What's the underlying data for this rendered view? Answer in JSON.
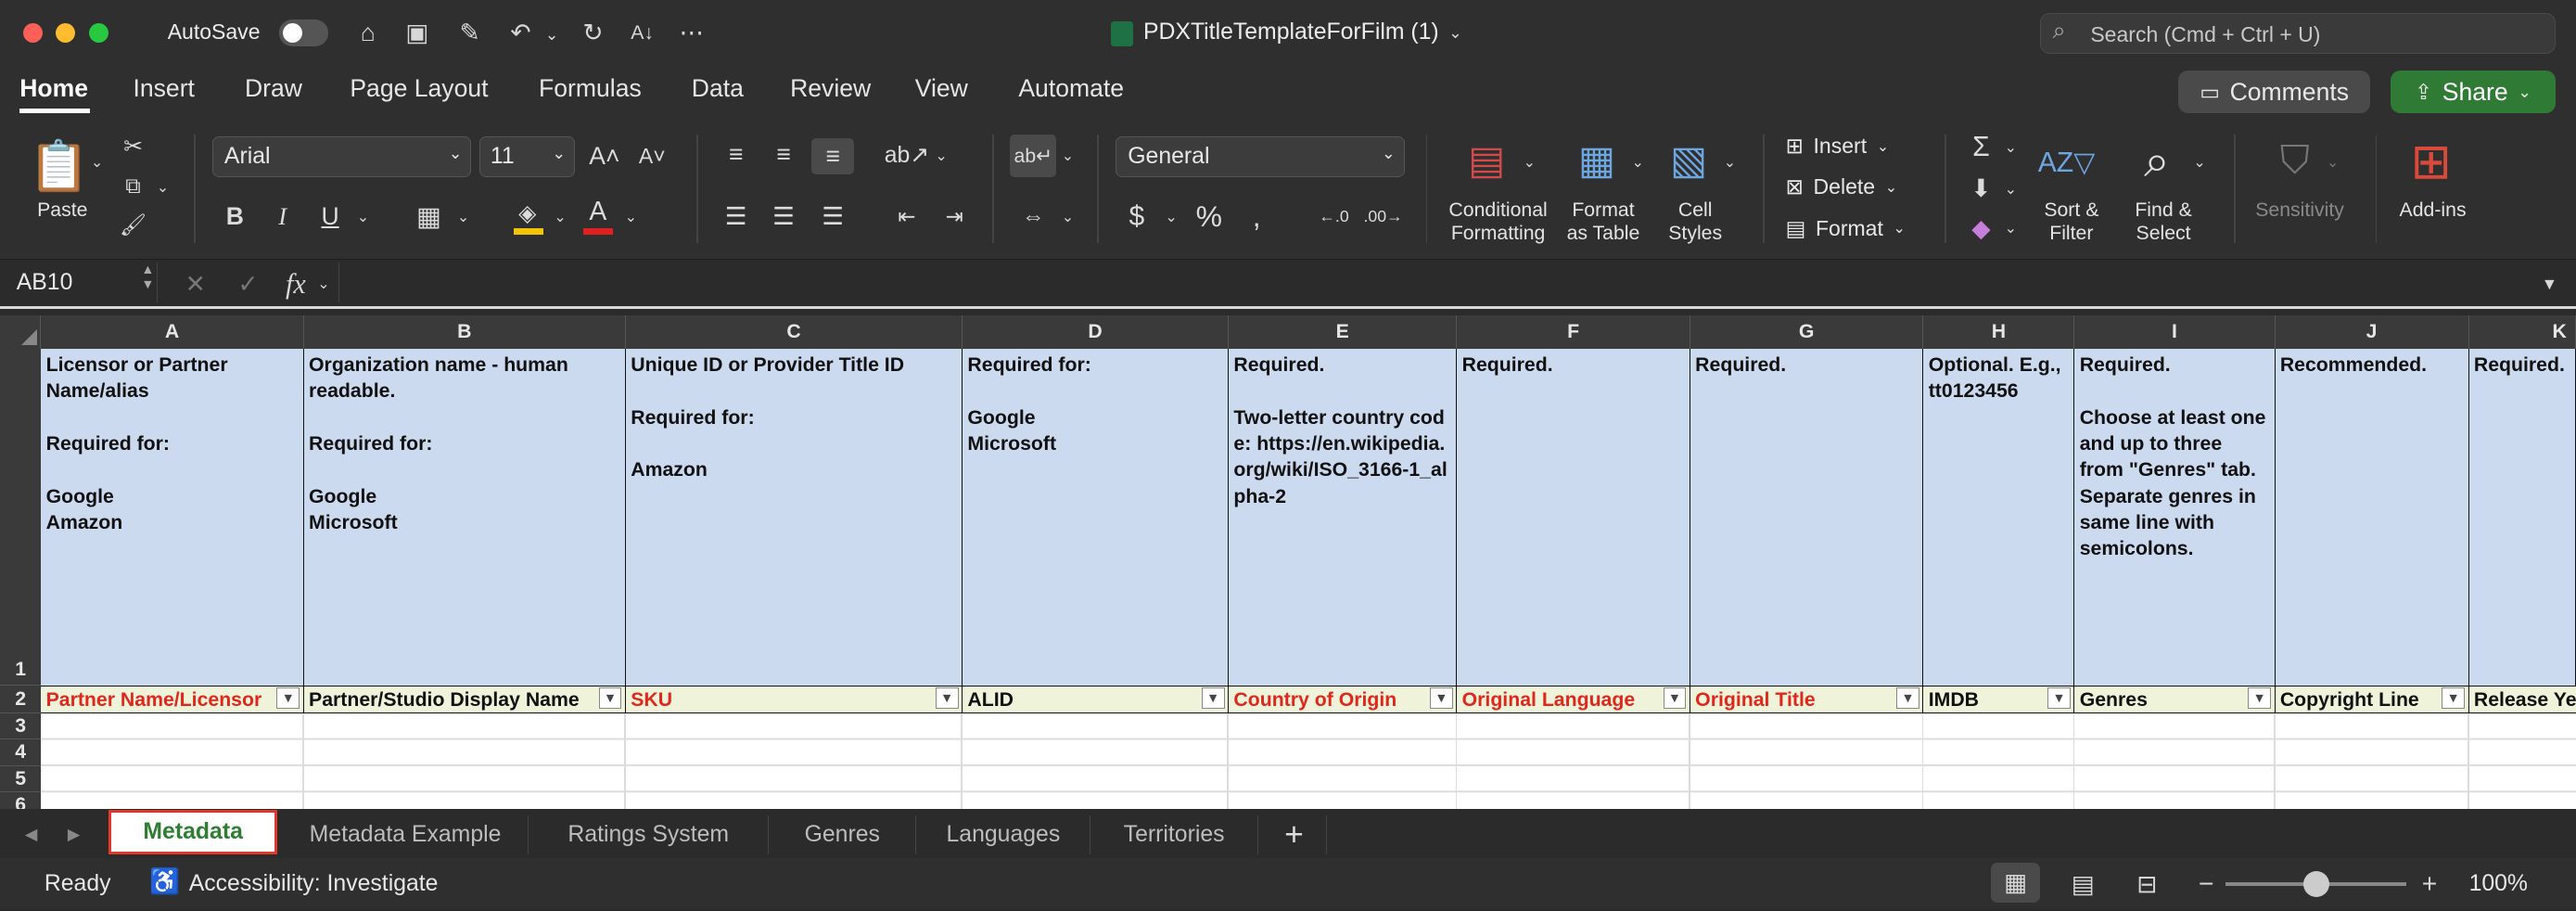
{
  "titlebar": {
    "autosave_label": "AutoSave",
    "doc_title": "PDXTitleTemplateForFilm (1)",
    "search_placeholder": "Search (Cmd + Ctrl + U)"
  },
  "menu_tabs": [
    "Home",
    "Insert",
    "Draw",
    "Page Layout",
    "Formulas",
    "Data",
    "Review",
    "View",
    "Automate"
  ],
  "actions": {
    "comments": "Comments",
    "share": "Share"
  },
  "ribbon": {
    "paste": "Paste",
    "font_name": "Arial",
    "font_size": "11",
    "number_format": "General",
    "conditional": [
      "Conditional",
      "Formatting"
    ],
    "format_table": [
      "Format",
      "as Table"
    ],
    "cell_styles": [
      "Cell",
      "Styles"
    ],
    "insert": "Insert",
    "delete": "Delete",
    "format": "Format",
    "sort_filter": [
      "Sort &",
      "Filter"
    ],
    "find_select": [
      "Find &",
      "Select"
    ],
    "sensitivity": "Sensitivity",
    "addins": "Add-ins"
  },
  "formula_bar": {
    "name_box": "AB10",
    "fx": "fx",
    "content": ""
  },
  "columns": [
    "A",
    "B",
    "C",
    "D",
    "E",
    "F",
    "G",
    "H",
    "I",
    "J",
    "K"
  ],
  "row_numbers": [
    "1",
    "2",
    "3",
    "4",
    "5",
    "6"
  ],
  "row1": [
    "Licensor or Partner Name/alias\n\nRequired for:\n\nGoogle\nAmazon",
    "Organization name - human readable.\n\nRequired for:\n\nGoogle\nMicrosoft",
    "Unique ID or Provider Title ID\n\nRequired for:\n\nAmazon",
    "Required for:\n\nGoogle\nMicrosoft",
    "Required.\n\nTwo-letter country code: https://en.wikipedia.org/wiki/ISO_3166-1_alpha-2",
    "Required.",
    "Required.",
    "Optional. E.g., tt0123456",
    "Required.\n\nChoose at least one and up to three from \"Genres\" tab. Separate genres in same line with semicolons.",
    "Recommended.",
    "Required."
  ],
  "row2": [
    {
      "text": "Partner Name/Licensor",
      "required": true
    },
    {
      "text": "Partner/Studio Display Name",
      "required": false
    },
    {
      "text": "SKU",
      "required": true
    },
    {
      "text": "ALID",
      "required": false
    },
    {
      "text": "Country of Origin",
      "required": true
    },
    {
      "text": "Original Language",
      "required": true
    },
    {
      "text": "Original Title",
      "required": true
    },
    {
      "text": "IMDB",
      "required": false
    },
    {
      "text": "Genres",
      "required": false
    },
    {
      "text": "Copyright Line",
      "required": false
    },
    {
      "text": "Release Ye",
      "required": false
    }
  ],
  "sheet_tabs": [
    "Metadata",
    "Metadata Example",
    "Ratings System",
    "Genres",
    "Languages",
    "Territories"
  ],
  "active_sheet": "Metadata",
  "status": {
    "ready": "Ready",
    "accessibility": "Accessibility: Investigate",
    "zoom": "100%"
  },
  "colors": {
    "accent": "#2e7d32",
    "required_red": "#e0271b",
    "header_blue": "#ccdaf0",
    "header_green": "#eef3d9",
    "share_green": "#2f7a34"
  }
}
